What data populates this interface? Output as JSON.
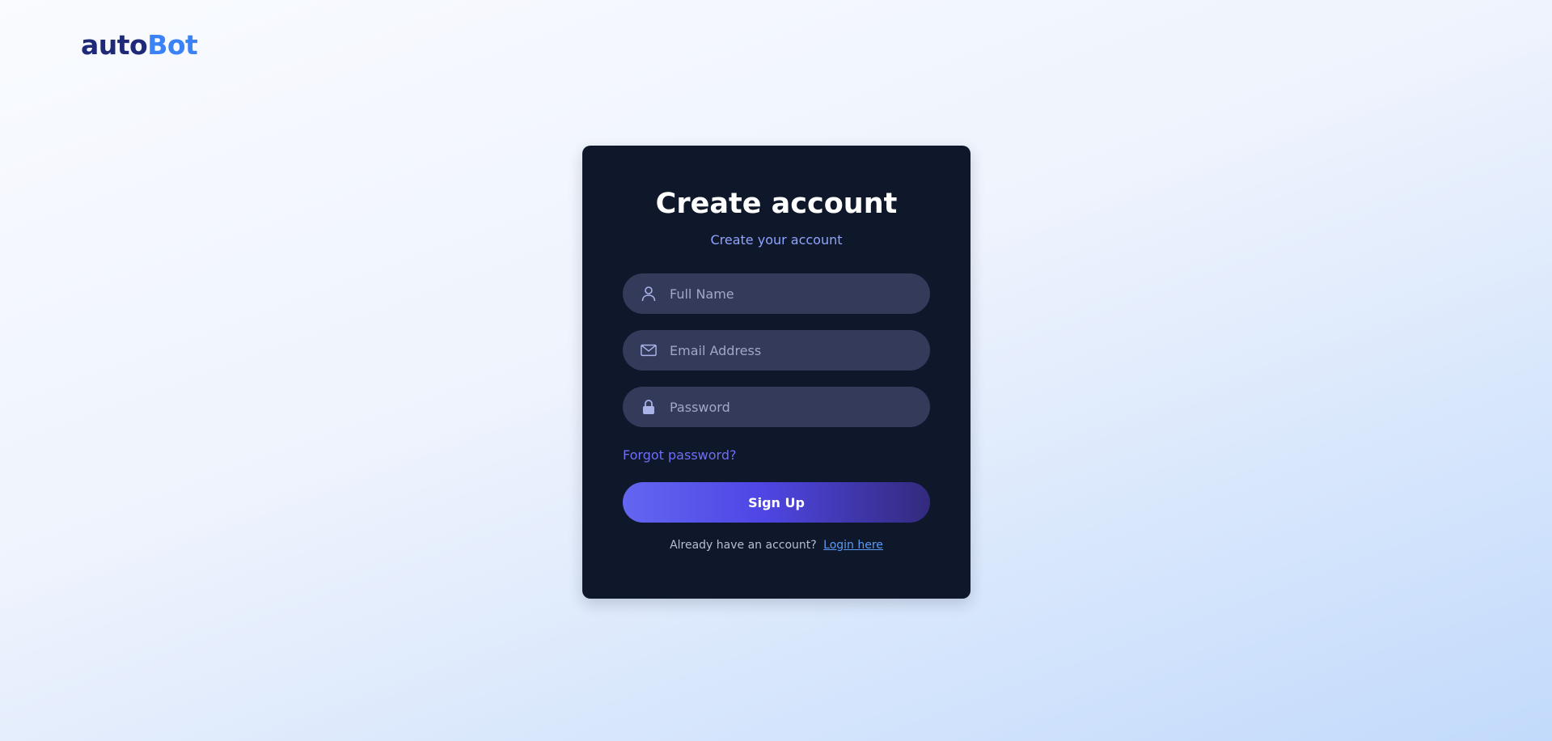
{
  "brand": {
    "part1": "auto",
    "part2": "Bot"
  },
  "card": {
    "title": "Create account",
    "subtitle": "Create your account"
  },
  "form": {
    "full_name": {
      "placeholder": "Full Name",
      "icon": "user-icon",
      "value": ""
    },
    "email": {
      "placeholder": "Email Address",
      "icon": "mail-icon",
      "value": ""
    },
    "password": {
      "placeholder": "Password",
      "icon": "lock-icon",
      "value": ""
    },
    "forgot_label": "Forgot password?",
    "submit_label": "Sign Up"
  },
  "footer": {
    "prompt": "Already have an account?",
    "login_label": "Login here"
  },
  "colors": {
    "card_bg": "#0f172a",
    "input_bg": "#343a5a",
    "accent": "#6366f1",
    "link": "#5a9bf6",
    "brand_dark": "#1e2a78",
    "brand_light": "#3b82f6"
  }
}
